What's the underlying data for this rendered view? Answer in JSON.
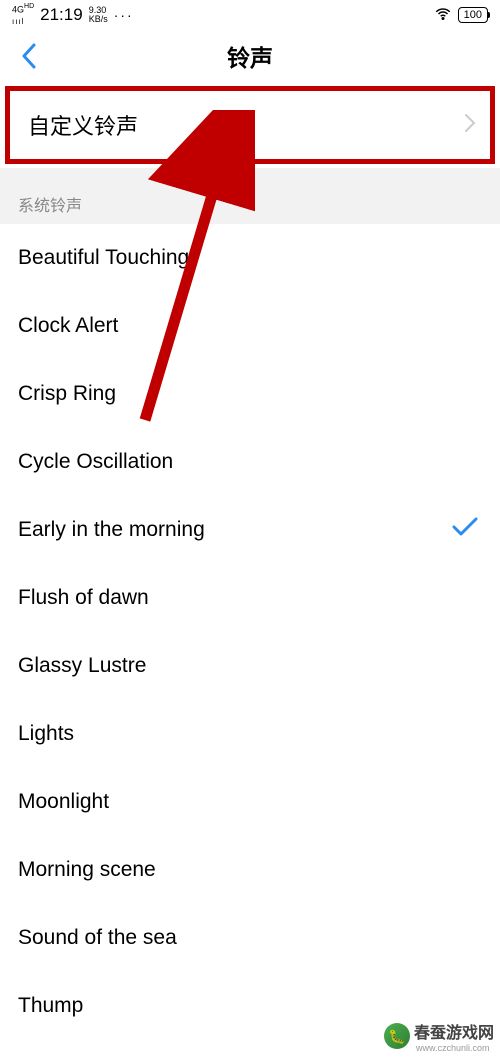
{
  "status_bar": {
    "signal": "4G HD",
    "time": "21:19",
    "data_rate": "9.30",
    "data_unit": "KB/s",
    "more": "···",
    "battery": "100"
  },
  "header": {
    "title": "铃声"
  },
  "custom_row": {
    "label": "自定义铃声"
  },
  "section_header": "系统铃声",
  "ringtones": [
    {
      "name": "Beautiful Touching",
      "selected": false
    },
    {
      "name": "Clock Alert",
      "selected": false
    },
    {
      "name": "Crisp Ring",
      "selected": false
    },
    {
      "name": "Cycle Oscillation",
      "selected": false
    },
    {
      "name": "Early in the morning",
      "selected": true
    },
    {
      "name": "Flush of dawn",
      "selected": false
    },
    {
      "name": "Glassy Lustre",
      "selected": false
    },
    {
      "name": "Lights",
      "selected": false
    },
    {
      "name": "Moonlight",
      "selected": false
    },
    {
      "name": "Morning scene",
      "selected": false
    },
    {
      "name": "Sound of the sea",
      "selected": false
    },
    {
      "name": "Thump",
      "selected": false
    }
  ],
  "watermark": {
    "text": "春蚕游戏网",
    "url": "www.czchunli.com"
  },
  "colors": {
    "highlight_border": "#c00000",
    "arrow": "#c00000",
    "check": "#2a8bf2",
    "back": "#2a8bf2"
  }
}
